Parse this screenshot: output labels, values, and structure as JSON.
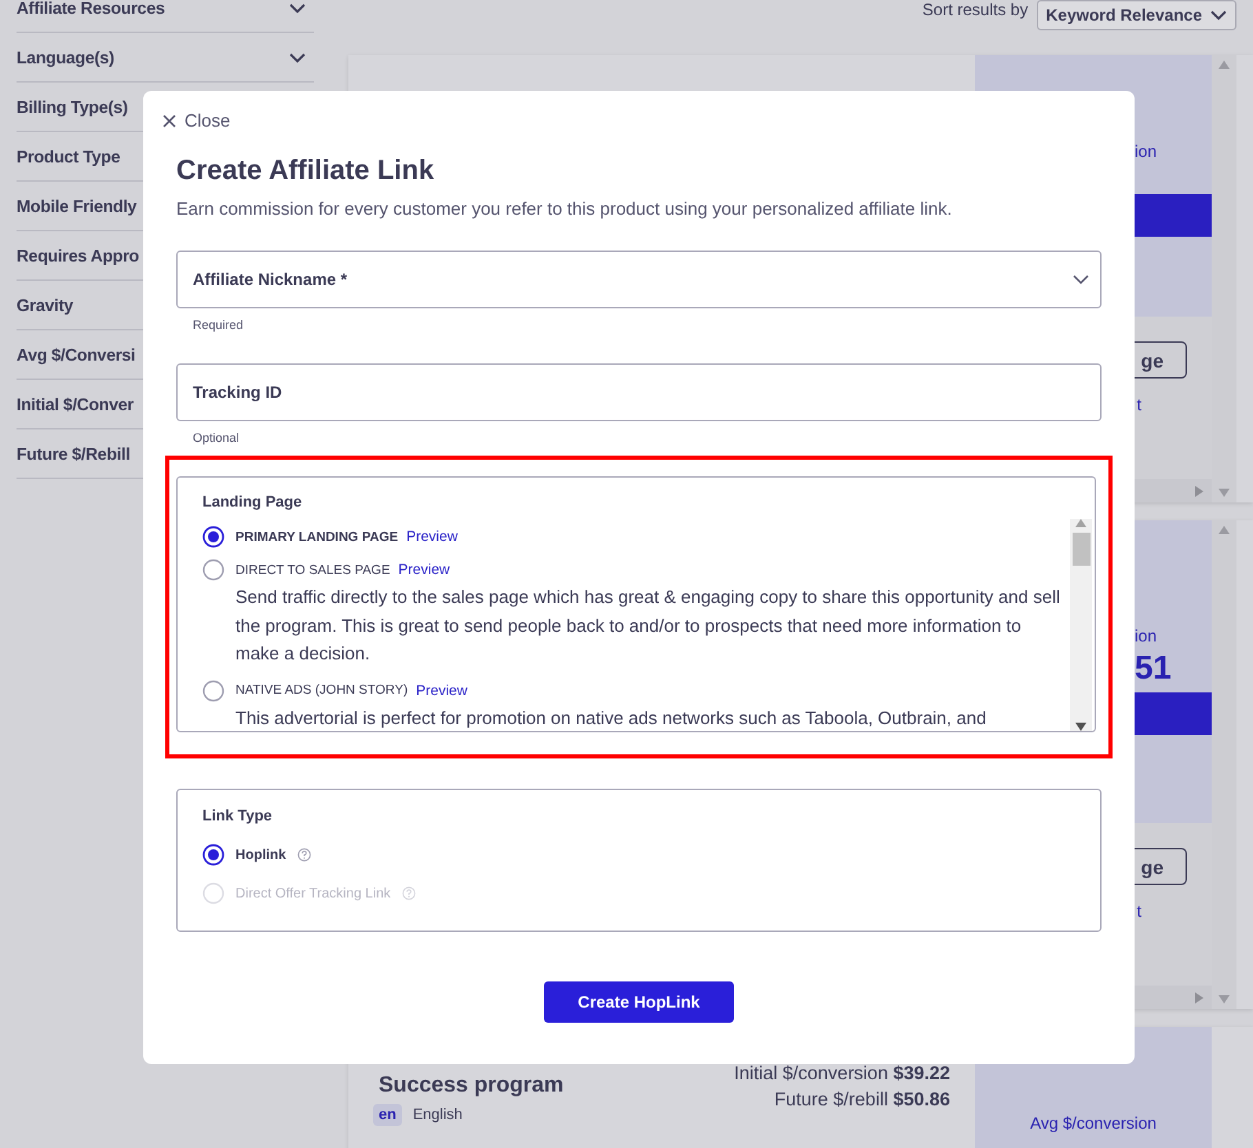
{
  "sidebar": {
    "filters": [
      {
        "label": "Affiliate Resources",
        "kind": "dropdown"
      },
      {
        "label": "Language(s)",
        "kind": "dropdown"
      },
      {
        "label": "Billing Type(s)",
        "kind": "plain"
      },
      {
        "label": "Product Type",
        "kind": "plain"
      },
      {
        "label": "Mobile Friendly",
        "kind": "plain"
      },
      {
        "label": "Requires Appro",
        "kind": "plain"
      },
      {
        "label": "Gravity",
        "kind": "plain"
      },
      {
        "label": "Avg $/Conversi",
        "kind": "plain"
      },
      {
        "label": "Initial $/Conver",
        "kind": "plain"
      },
      {
        "label": "Future $/Rebill",
        "kind": "plain"
      }
    ]
  },
  "sort": {
    "label": "Sort results by",
    "value": "Keyword Relevance"
  },
  "cards": [
    {
      "kind": "partial",
      "metric_fragment": "ion",
      "button_fragment": "ge",
      "link_fragment": "t"
    },
    {
      "kind": "partial",
      "metric_fragment": "ion",
      "price_fragment": "51",
      "button_fragment": "ge",
      "link_fragment": "t"
    },
    {
      "kind": "bottom",
      "title": "Success program",
      "stats": [
        {
          "label": "Initial $/conversion",
          "value": "$39.22"
        },
        {
          "label": "Future $/rebill",
          "value": "$50.86"
        }
      ],
      "language_code": "en",
      "language": "English",
      "metric_label": "Avg $/conversion"
    }
  ],
  "modal": {
    "close": "Close",
    "title": "Create Affiliate Link",
    "subtitle": "Earn commission for every customer you refer to this product using your personalized affiliate link.",
    "fields": [
      {
        "label": "Affiliate Nickname *",
        "kind": "select",
        "hint": "Required"
      },
      {
        "label": "Tracking ID",
        "kind": "text",
        "hint": "Optional"
      }
    ],
    "landing_page": {
      "title": "Landing Page",
      "highlighted": true,
      "options": [
        {
          "label": "PRIMARY LANDING PAGE",
          "link": "Preview",
          "selected": true
        },
        {
          "label": "DIRECT TO SALES PAGE",
          "link": "Preview",
          "selected": false,
          "description": "Send traffic directly to the sales page which has great & engaging copy to share this opportunity and sell the program. This is great to send people back to and/or to prospects that need more information to make a decision."
        },
        {
          "label": "NATIVE ADS (JOHN STORY)",
          "link": "Preview",
          "selected": false,
          "description": "This advertorial is perfect for promotion on native ads networks such as Taboola, Outbrain, and"
        }
      ]
    },
    "link_type": {
      "title": "Link Type",
      "options": [
        {
          "label": "Hoplink",
          "selected": true,
          "disabled": false
        },
        {
          "label": "Direct Offer Tracking Link",
          "selected": false,
          "disabled": true
        }
      ]
    },
    "submit": "Create HopLink"
  }
}
